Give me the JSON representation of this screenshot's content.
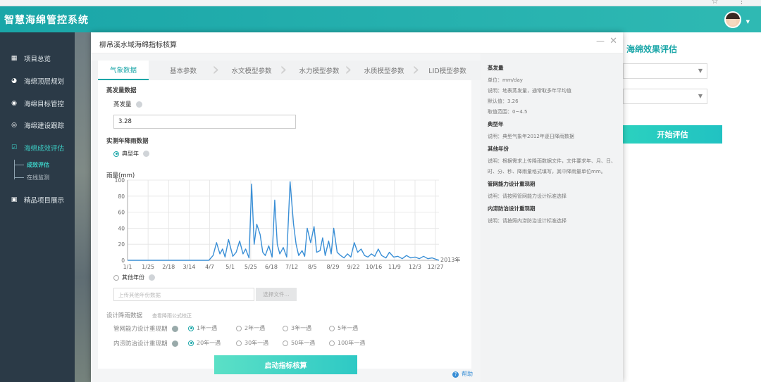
{
  "app": {
    "title": "智慧海绵管控系统"
  },
  "sidebar": {
    "items": [
      {
        "label": "项目总览",
        "icon": "grid-icon"
      },
      {
        "label": "海绵顶层规划",
        "icon": "pie-icon"
      },
      {
        "label": "海绵目标管控",
        "icon": "target-icon"
      },
      {
        "label": "海绵建设跟踪",
        "icon": "eye-icon"
      },
      {
        "label": "海绵成效评估",
        "icon": "checkbox-icon"
      },
      {
        "label": "精品项目展示",
        "icon": "monitor-icon"
      }
    ],
    "subitems": [
      {
        "label": "成效评估"
      },
      {
        "label": "在线监测"
      }
    ]
  },
  "background_panel": {
    "title": "海绵效果评估",
    "button": "开始评估"
  },
  "modal": {
    "title": "柳吊溪水域海绵指标核算",
    "tabs": [
      "气象数据",
      "基本参数",
      "水文模型参数",
      "水力模型参数",
      "水质模型参数",
      "LID模型参数"
    ],
    "evaporation": {
      "section": "蒸发量数据",
      "label": "蒸发量",
      "value": "3.28"
    },
    "rainfall": {
      "section": "实测年降雨数据",
      "option_typical": "典型年",
      "option_other": "其他年份",
      "upload_placeholder": "上传其他年份数据",
      "upload_button": "选择文件..."
    },
    "design": {
      "section": "设计降雨数据",
      "note": "查看降雨公式校正",
      "row1_label": "管网能力设计重现期",
      "row1_options": [
        "1年一遇",
        "2年一遇",
        "3年一遇",
        "5年一遇"
      ],
      "row2_label": "内涝防治设计重现期",
      "row2_options": [
        "20年一遇",
        "30年一遇",
        "50年一遇",
        "100年一遇"
      ]
    },
    "submit": "启动指标核算",
    "help": "帮助"
  },
  "info_panel": {
    "blocks": [
      {
        "head": "蒸发量",
        "lines": [
          "单位：mm/day",
          "说明：地表蒸发量，通常取多年平均值",
          "默认值：3.26",
          "取值范围：0~4.5"
        ]
      },
      {
        "head": "典型年",
        "lines": [
          "说明：典型气象年2012年逐日降雨数据"
        ]
      },
      {
        "head": "其他年份",
        "lines": [
          "说明：根据需求上传降雨数据文件，文件要求年、月、日、时、分、秒、降雨量格式填写，其中降雨量单位mm。"
        ]
      },
      {
        "head": "管网能力设计重现期",
        "lines": [
          "说明：请按照管网能力设计标准选择"
        ]
      },
      {
        "head": "内涝防治设计重现期",
        "lines": [
          "说明：请按照内涝防治设计标准选择"
        ]
      }
    ]
  },
  "chart_data": {
    "type": "line",
    "ylabel": "雨量(mm)",
    "xlabel_right": "2013年",
    "ylim": [
      0,
      100
    ],
    "yticks": [
      0,
      20,
      40,
      60,
      80,
      100
    ],
    "xtick_labels": [
      "1/1",
      "1/25",
      "2/18",
      "3/14",
      "4/7",
      "5/1",
      "5/25",
      "6/18",
      "7/12",
      "8/5",
      "8/29",
      "9/22",
      "10/16",
      "11/9",
      "12/3",
      "12/27"
    ],
    "color": "#3a8fd6",
    "grid": true,
    "x_days": [
      0,
      95,
      100,
      104,
      108,
      111,
      114,
      118,
      123,
      127,
      131,
      135,
      138,
      142,
      145,
      148,
      151,
      155,
      158,
      161,
      165,
      169,
      172,
      175,
      178,
      182,
      186,
      190,
      194,
      197,
      200,
      204,
      207,
      210,
      214,
      218,
      221,
      225,
      228,
      231,
      235,
      238,
      241,
      245,
      249,
      253,
      257,
      261,
      265,
      269,
      273,
      277,
      281,
      285,
      289,
      293,
      297,
      302,
      306,
      311,
      316,
      321,
      326,
      331,
      336,
      341,
      346,
      351,
      356,
      364
    ],
    "values": [
      0,
      0,
      6,
      22,
      8,
      14,
      4,
      26,
      5,
      10,
      24,
      8,
      14,
      3,
      95,
      20,
      45,
      32,
      10,
      6,
      18,
      4,
      75,
      20,
      8,
      16,
      4,
      98,
      45,
      20,
      6,
      12,
      5,
      40,
      22,
      42,
      10,
      12,
      28,
      6,
      24,
      8,
      40,
      10,
      6,
      3,
      8,
      4,
      22,
      10,
      14,
      6,
      4,
      8,
      5,
      14,
      6,
      3,
      10,
      4,
      5,
      2,
      6,
      3,
      4,
      2,
      5,
      2,
      3,
      0
    ]
  }
}
